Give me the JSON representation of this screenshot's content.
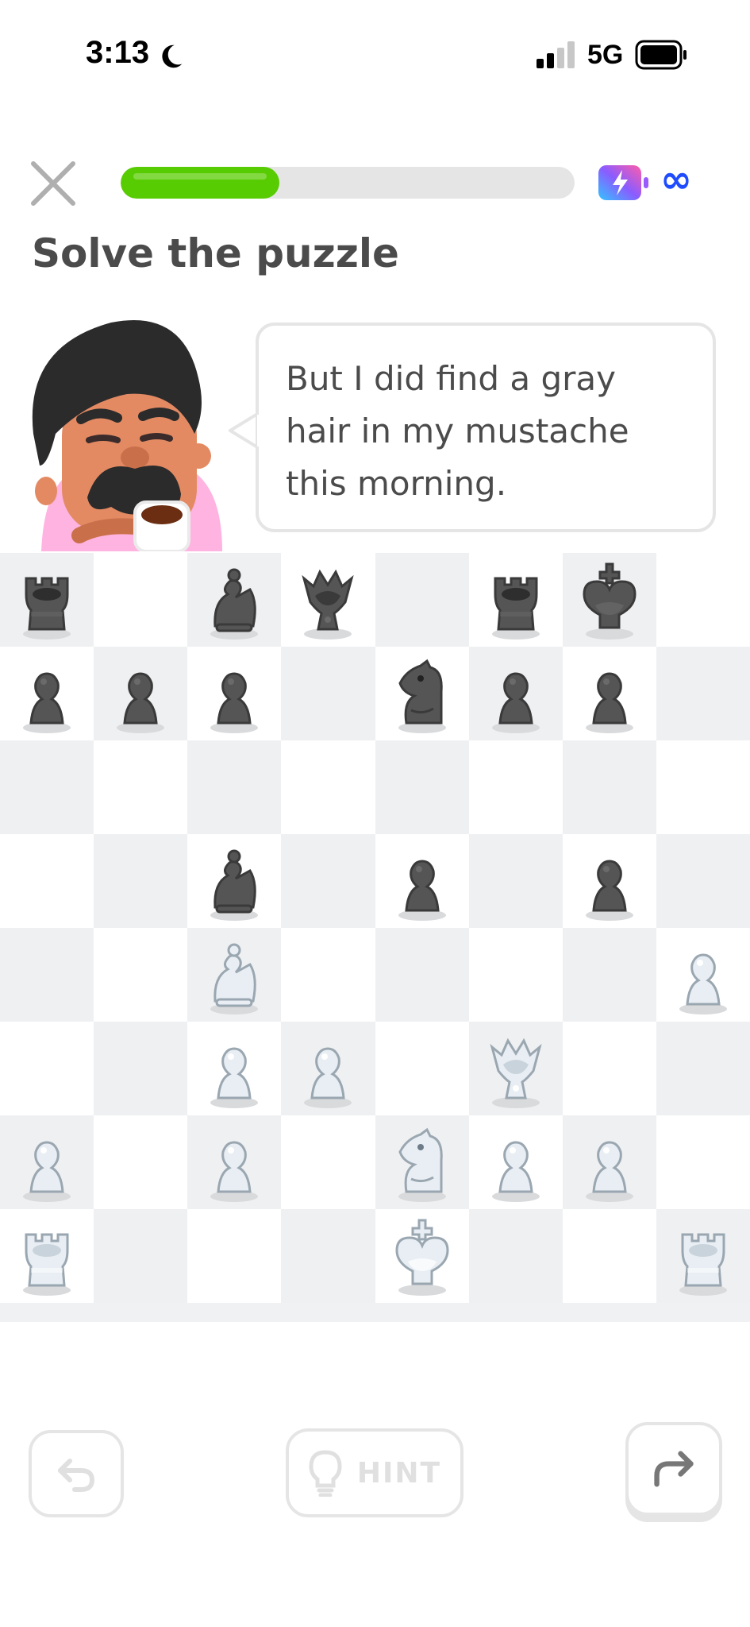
{
  "status_bar": {
    "time": "3:13",
    "network": "5G"
  },
  "header": {
    "progress_percent": 35,
    "energy_value": "∞",
    "colors": {
      "progress": "#58cc02",
      "energy": "#1f4cff"
    }
  },
  "title": "Solve the puzzle",
  "speech_bubble": {
    "text": "But I did find a gray hair in my mustache this morning."
  },
  "board": {
    "orientation": "white-bottom",
    "ranks": [
      [
        "bR",
        "",
        "bB",
        "bQ",
        "",
        "bR",
        "bK",
        ""
      ],
      [
        "bP",
        "bP",
        "bP",
        "",
        "bN",
        "bP",
        "bP",
        ""
      ],
      [
        "",
        "",
        "",
        "",
        "",
        "",
        "",
        ""
      ],
      [
        "",
        "",
        "bB",
        "",
        "bP",
        "",
        "bP",
        ""
      ],
      [
        "",
        "",
        "wB",
        "",
        "",
        "",
        "",
        "wP"
      ],
      [
        "",
        "",
        "wP",
        "wP",
        "",
        "wQ",
        "",
        ""
      ],
      [
        "wP",
        "",
        "wP",
        "",
        "wN",
        "wP",
        "wP",
        ""
      ],
      [
        "wR",
        "",
        "",
        "",
        "wK",
        "",
        "",
        "wR"
      ]
    ],
    "piece_names": {
      "P": "pawn",
      "N": "knight",
      "B": "bishop",
      "R": "rook",
      "Q": "queen",
      "K": "king"
    }
  },
  "controls": {
    "undo_icon": "undo-arrow-icon",
    "hint_label": "HINT",
    "hint_icon": "lightbulb-icon",
    "redo_icon": "redo-arrow-icon"
  }
}
